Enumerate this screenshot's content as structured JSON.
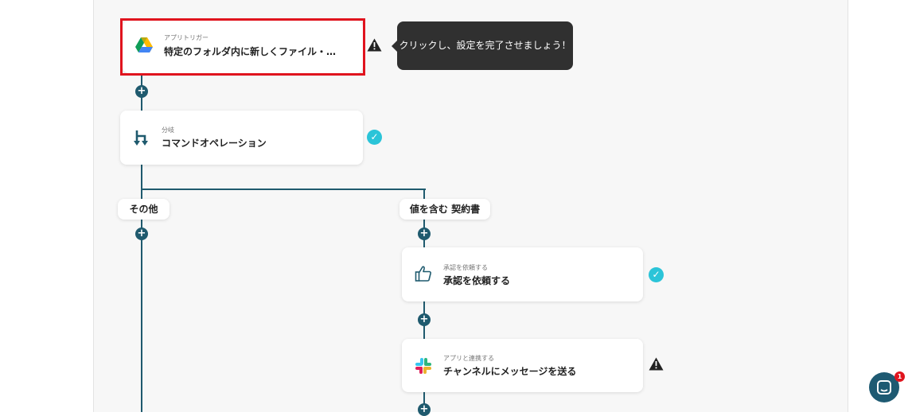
{
  "trigger": {
    "sub": "アプリトリガー",
    "title": "特定のフォルダ内に新しくファイル・…",
    "icon": "google-drive-icon",
    "status": "warning"
  },
  "tooltip": {
    "text": "クリックし、設定を完了させましょう！"
  },
  "branch_card": {
    "sub": "分岐",
    "title": "コマンドオペレーション",
    "icon": "branch-icon",
    "status": "complete"
  },
  "branches": {
    "left_label": "その他",
    "right_label": "値を含む 契約書"
  },
  "approval_card": {
    "sub": "承認を依頼する",
    "title": "承認を依頼する",
    "icon": "thumbs-up-icon",
    "status": "complete"
  },
  "slack_card": {
    "sub": "アプリと連携する",
    "title": "チャンネルにメッセージを送る",
    "icon": "slack-icon",
    "status": "warning"
  },
  "add_step_symbol": "+",
  "check_symbol": "✓",
  "chat": {
    "badge_count": "1"
  },
  "colors": {
    "connector": "#1f5a6e",
    "highlight": "#e0141e",
    "check": "#2bc4d8",
    "tooltip_bg": "#303030"
  }
}
